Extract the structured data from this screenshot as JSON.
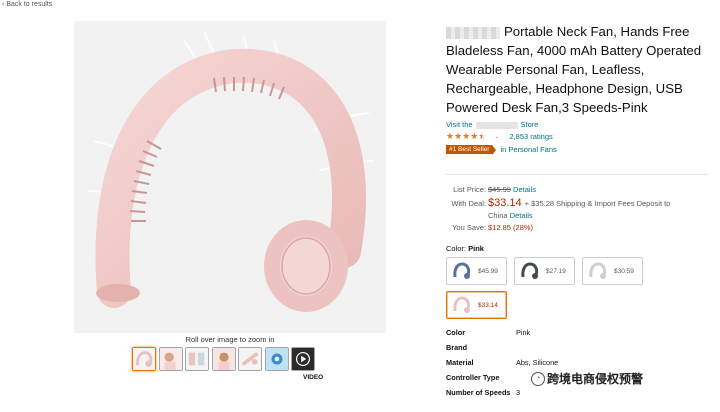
{
  "nav": {
    "back_label": "Back to results"
  },
  "gallery": {
    "rollover_text": "Roll over image to zoom in",
    "video_label": "VIDEO",
    "thumbnail_count": 7
  },
  "product": {
    "title": "Portable Neck Fan, Hands Free Bladeless Fan, 4000 mAh Battery Operated Wearable Personal Fan, Leafless, Rechargeable, Headphone Design, USB Powered Desk Fan,3 Speeds-Pink",
    "visit_prefix": "Visit the",
    "visit_suffix": "Store",
    "rating_stars": 4.5,
    "ratings_count": "2,853 ratings",
    "best_seller_badge": "#1 Best Seller",
    "best_seller_category": "in Personal Fans"
  },
  "pricing": {
    "list_label": "List Price:",
    "list_price": "$45.99",
    "details_link": "Details",
    "deal_label": "With Deal:",
    "deal_price": "$33.14",
    "shipping_text": "+ $35.28 Shipping & Import Fees Deposit to",
    "shipping_country": "China",
    "save_label": "You Save:",
    "save_amount": "$12.85 (28%)"
  },
  "color": {
    "label": "Color:",
    "selected": "Pink",
    "options": [
      {
        "price": "$45.99",
        "swatch": "#5b6f9a"
      },
      {
        "price": "$27.19",
        "swatch": "#3f4f4a"
      },
      {
        "price": "$30.59",
        "swatch": "#e8e8e8"
      },
      {
        "price": "$33.14",
        "swatch": "#f0c7c7"
      }
    ]
  },
  "specs": [
    {
      "key": "Color",
      "value": "Pink"
    },
    {
      "key": "Brand",
      "value": ""
    },
    {
      "key": "Material",
      "value": "Abs, Silicone"
    },
    {
      "key": "Controller Type",
      "value": ""
    },
    {
      "key": "Number of Speeds",
      "value": "3"
    }
  ],
  "watermark": {
    "text": "跨境电商侵权预警"
  },
  "colors": {
    "link": "#007185",
    "price_red": "#b12704",
    "star": "#de7921",
    "badge": "#c45500",
    "select_orange": "#e77600"
  }
}
